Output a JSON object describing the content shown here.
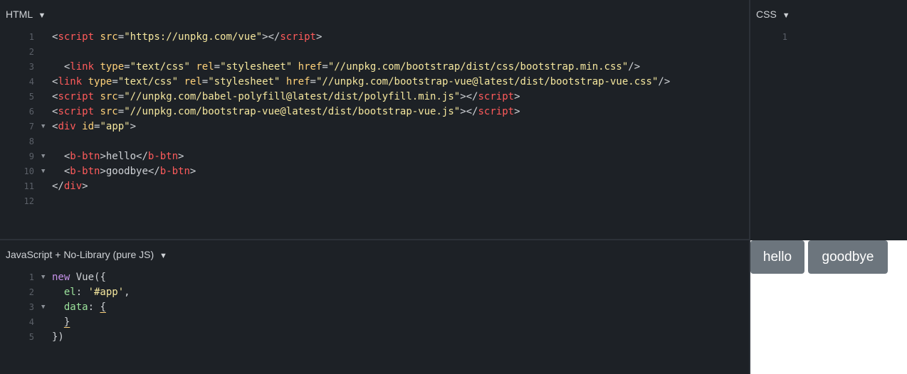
{
  "html_panel": {
    "title": "HTML",
    "lines": [
      {
        "n": "1",
        "fold": false,
        "indent": "",
        "segs": [
          {
            "c": "pun",
            "t": "<"
          },
          {
            "c": "tag",
            "t": "script"
          },
          {
            "c": "pun",
            "t": " "
          },
          {
            "c": "attr",
            "t": "src"
          },
          {
            "c": "pun",
            "t": "="
          },
          {
            "c": "str",
            "t": "\"https://unpkg.com/vue\""
          },
          {
            "c": "pun",
            "t": "></"
          },
          {
            "c": "tag",
            "t": "script"
          },
          {
            "c": "pun",
            "t": ">"
          }
        ]
      },
      {
        "n": "2",
        "fold": false,
        "indent": "",
        "segs": []
      },
      {
        "n": "3",
        "fold": false,
        "indent": "  ",
        "segs": [
          {
            "c": "pun",
            "t": "<"
          },
          {
            "c": "tag",
            "t": "link"
          },
          {
            "c": "pun",
            "t": " "
          },
          {
            "c": "attr",
            "t": "type"
          },
          {
            "c": "pun",
            "t": "="
          },
          {
            "c": "str",
            "t": "\"text/css\""
          },
          {
            "c": "pun",
            "t": " "
          },
          {
            "c": "attr",
            "t": "rel"
          },
          {
            "c": "pun",
            "t": "="
          },
          {
            "c": "str",
            "t": "\"stylesheet\""
          },
          {
            "c": "pun",
            "t": " "
          },
          {
            "c": "attr",
            "t": "href"
          },
          {
            "c": "pun",
            "t": "="
          },
          {
            "c": "str",
            "t": "\"//unpkg.com/bootstrap/dist/css/bootstrap.min.css\""
          },
          {
            "c": "pun",
            "t": "/>"
          }
        ]
      },
      {
        "n": "4",
        "fold": false,
        "indent": "",
        "segs": [
          {
            "c": "pun",
            "t": "<"
          },
          {
            "c": "tag",
            "t": "link"
          },
          {
            "c": "pun",
            "t": " "
          },
          {
            "c": "attr",
            "t": "type"
          },
          {
            "c": "pun",
            "t": "="
          },
          {
            "c": "str",
            "t": "\"text/css\""
          },
          {
            "c": "pun",
            "t": " "
          },
          {
            "c": "attr",
            "t": "rel"
          },
          {
            "c": "pun",
            "t": "="
          },
          {
            "c": "str",
            "t": "\"stylesheet\""
          },
          {
            "c": "pun",
            "t": " "
          },
          {
            "c": "attr",
            "t": "href"
          },
          {
            "c": "pun",
            "t": "="
          },
          {
            "c": "str",
            "t": "\"//unpkg.com/bootstrap-vue@latest/dist/bootstrap-vue.css\""
          },
          {
            "c": "pun",
            "t": "/>"
          }
        ]
      },
      {
        "n": "5",
        "fold": false,
        "indent": "",
        "segs": [
          {
            "c": "pun",
            "t": "<"
          },
          {
            "c": "tag",
            "t": "script"
          },
          {
            "c": "pun",
            "t": " "
          },
          {
            "c": "attr",
            "t": "src"
          },
          {
            "c": "pun",
            "t": "="
          },
          {
            "c": "str",
            "t": "\"//unpkg.com/babel-polyfill@latest/dist/polyfill.min.js\""
          },
          {
            "c": "pun",
            "t": "></"
          },
          {
            "c": "tag",
            "t": "script"
          },
          {
            "c": "pun",
            "t": ">"
          }
        ]
      },
      {
        "n": "6",
        "fold": false,
        "indent": "",
        "segs": [
          {
            "c": "pun",
            "t": "<"
          },
          {
            "c": "tag",
            "t": "script"
          },
          {
            "c": "pun",
            "t": " "
          },
          {
            "c": "attr",
            "t": "src"
          },
          {
            "c": "pun",
            "t": "="
          },
          {
            "c": "str",
            "t": "\"//unpkg.com/bootstrap-vue@latest/dist/bootstrap-vue.js\""
          },
          {
            "c": "pun",
            "t": "></"
          },
          {
            "c": "tag",
            "t": "script"
          },
          {
            "c": "pun",
            "t": ">"
          }
        ]
      },
      {
        "n": "7",
        "fold": true,
        "indent": "",
        "segs": [
          {
            "c": "pun",
            "t": "<"
          },
          {
            "c": "tag",
            "t": "div"
          },
          {
            "c": "pun",
            "t": " "
          },
          {
            "c": "attr",
            "t": "id"
          },
          {
            "c": "pun",
            "t": "="
          },
          {
            "c": "str",
            "t": "\"app\""
          },
          {
            "c": "pun",
            "t": ">"
          }
        ]
      },
      {
        "n": "8",
        "fold": false,
        "indent": "",
        "segs": []
      },
      {
        "n": "9",
        "fold": true,
        "indent": "  ",
        "segs": [
          {
            "c": "pun",
            "t": "<"
          },
          {
            "c": "tag",
            "t": "b-btn"
          },
          {
            "c": "pun",
            "t": ">hello</"
          },
          {
            "c": "tag",
            "t": "b-btn"
          },
          {
            "c": "pun",
            "t": ">"
          }
        ]
      },
      {
        "n": "10",
        "fold": true,
        "indent": "  ",
        "segs": [
          {
            "c": "pun",
            "t": "<"
          },
          {
            "c": "tag",
            "t": "b-btn"
          },
          {
            "c": "pun",
            "t": ">goodbye</"
          },
          {
            "c": "tag",
            "t": "b-btn"
          },
          {
            "c": "pun",
            "t": ">"
          }
        ]
      },
      {
        "n": "11",
        "fold": false,
        "indent": "",
        "segs": [
          {
            "c": "pun",
            "t": "</"
          },
          {
            "c": "tag",
            "t": "div"
          },
          {
            "c": "pun",
            "t": ">"
          }
        ]
      },
      {
        "n": "12",
        "fold": false,
        "indent": "",
        "segs": []
      }
    ]
  },
  "css_panel": {
    "title": "CSS",
    "lines": [
      {
        "n": "1",
        "fold": false,
        "indent": "",
        "segs": []
      }
    ]
  },
  "js_panel": {
    "title": "JavaScript + No-Library (pure JS)",
    "lines": [
      {
        "n": "1",
        "fold": true,
        "indent": "",
        "segs": [
          {
            "c": "kw",
            "t": "new"
          },
          {
            "c": "pun",
            "t": " Vue({"
          }
        ]
      },
      {
        "n": "2",
        "fold": false,
        "indent": "  ",
        "segs": [
          {
            "c": "prop",
            "t": "el"
          },
          {
            "c": "pun",
            "t": ": "
          },
          {
            "c": "str",
            "t": "'#app'"
          },
          {
            "c": "pun",
            "t": ","
          }
        ]
      },
      {
        "n": "3",
        "fold": true,
        "indent": "  ",
        "segs": [
          {
            "c": "prop",
            "t": "data"
          },
          {
            "c": "pun",
            "t": ": "
          },
          {
            "c": "pun mb",
            "t": "{"
          }
        ]
      },
      {
        "n": "4",
        "fold": false,
        "indent": "  ",
        "segs": [
          {
            "c": "pun mb",
            "t": "}"
          }
        ]
      },
      {
        "n": "5",
        "fold": false,
        "indent": "",
        "segs": [
          {
            "c": "pun",
            "t": "})"
          }
        ]
      }
    ]
  },
  "result": {
    "buttons": [
      {
        "label": "hello"
      },
      {
        "label": "goodbye"
      }
    ],
    "button_color": "#6c757d"
  },
  "caret": "▼"
}
